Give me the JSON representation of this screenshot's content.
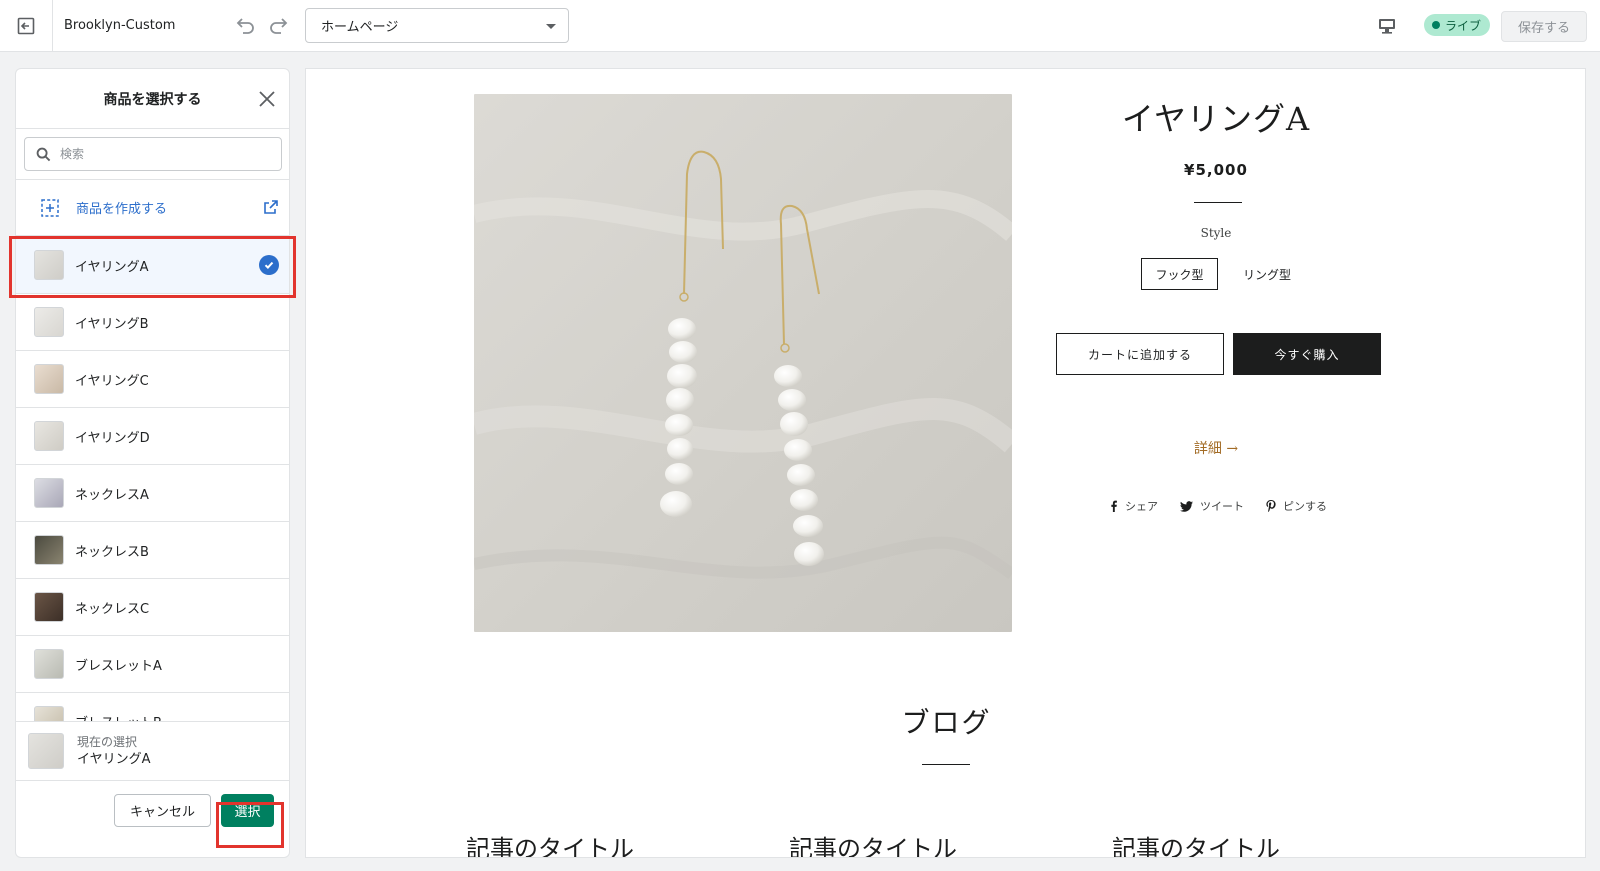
{
  "topbar": {
    "theme_name": "Brooklyn-Custom",
    "page_select_value": "ホームページ",
    "live_label": "ライブ",
    "save_label": "保存する"
  },
  "panel": {
    "title": "商品を選択する",
    "search_placeholder": "検索",
    "create_label": "商品を作成する",
    "items": [
      {
        "name": "イヤリングA",
        "selected": true
      },
      {
        "name": "イヤリングB"
      },
      {
        "name": "イヤリングC"
      },
      {
        "name": "イヤリングD"
      },
      {
        "name": "ネックレスA"
      },
      {
        "name": "ネックレスB"
      },
      {
        "name": "ネックレスC"
      },
      {
        "name": "ブレスレットA"
      },
      {
        "name": "ブレスレットB"
      }
    ],
    "current_label": "現在の選択",
    "current_value": "イヤリングA",
    "cancel_label": "キャンセル",
    "select_label": "選択"
  },
  "product": {
    "title": "イヤリングA",
    "price": "¥5,000",
    "style_label": "Style",
    "options": [
      "フック型",
      "リング型"
    ],
    "add_to_cart": "カートに追加する",
    "buy_now": "今すぐ購入",
    "details": "詳細 →",
    "share": {
      "facebook": "シェア",
      "twitter": "ツイート",
      "pinterest": "ピンする"
    }
  },
  "blog": {
    "title": "ブログ",
    "articles": [
      "記事のタイトル",
      "記事のタイトル",
      "記事のタイトル"
    ]
  },
  "colors": {
    "accent_blue": "#2c6ecb",
    "primary_green": "#008060",
    "highlight_red": "#e2342d",
    "details_gold": "#a26b25"
  }
}
